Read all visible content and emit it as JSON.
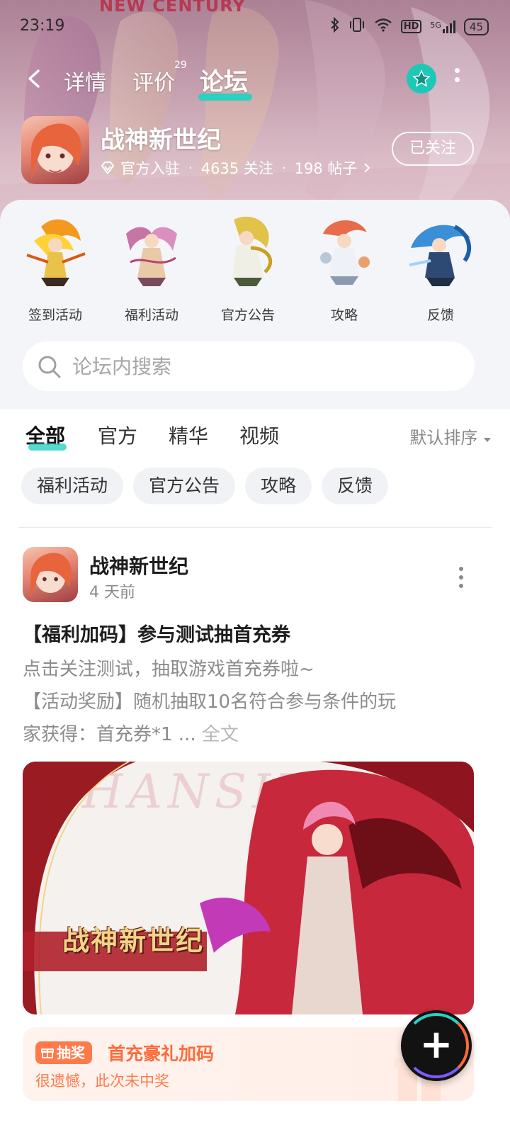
{
  "banner": {
    "title": "NEW CENTURY"
  },
  "status_bar": {
    "time": "23:19",
    "signal": "5G",
    "hd": "HD",
    "battery": "45"
  },
  "nav": {
    "tabs": [
      {
        "label": "详情"
      },
      {
        "label": "评价",
        "badge": "29"
      },
      {
        "label": "论坛"
      }
    ],
    "active_tab": "论坛",
    "accent_color": "#2ad1c1"
  },
  "app": {
    "name": "战神新世纪",
    "official": "官方入驻",
    "followers": "4635 关注",
    "posts": "198 帖子",
    "follow_button": "已关注"
  },
  "quick_links": [
    {
      "label": "签到活动"
    },
    {
      "label": "福利活动"
    },
    {
      "label": "官方公告"
    },
    {
      "label": "攻略"
    },
    {
      "label": "反馈"
    }
  ],
  "search": {
    "placeholder": "论坛内搜索"
  },
  "filter_tabs": [
    {
      "label": "全部"
    },
    {
      "label": "官方"
    },
    {
      "label": "精华"
    },
    {
      "label": "视频"
    }
  ],
  "sort": {
    "label": "默认排序"
  },
  "chips": [
    {
      "label": "福利活动"
    },
    {
      "label": "官方公告"
    },
    {
      "label": "攻略"
    },
    {
      "label": "反馈"
    }
  ],
  "post": {
    "author": "战神新世纪",
    "time": "4 天前",
    "title": "【福利加码】参与测试抽首充券",
    "body_line1": "点击关注测试，抽取游戏首充券啦~",
    "body_line2": "【活动奖励】随机抽取10名符合参与条件的玩",
    "body_line3": "家获得：首充券*1",
    "ellipsis": " ... ",
    "full_text": "全文",
    "image_watermark": "ZHANSHEN",
    "image_logo": "战神新世纪"
  },
  "lottery": {
    "tag": "抽奖",
    "title": "首充豪礼加码",
    "result": "很遗憾，此次未中奖",
    "color": "#ff6b3a"
  }
}
